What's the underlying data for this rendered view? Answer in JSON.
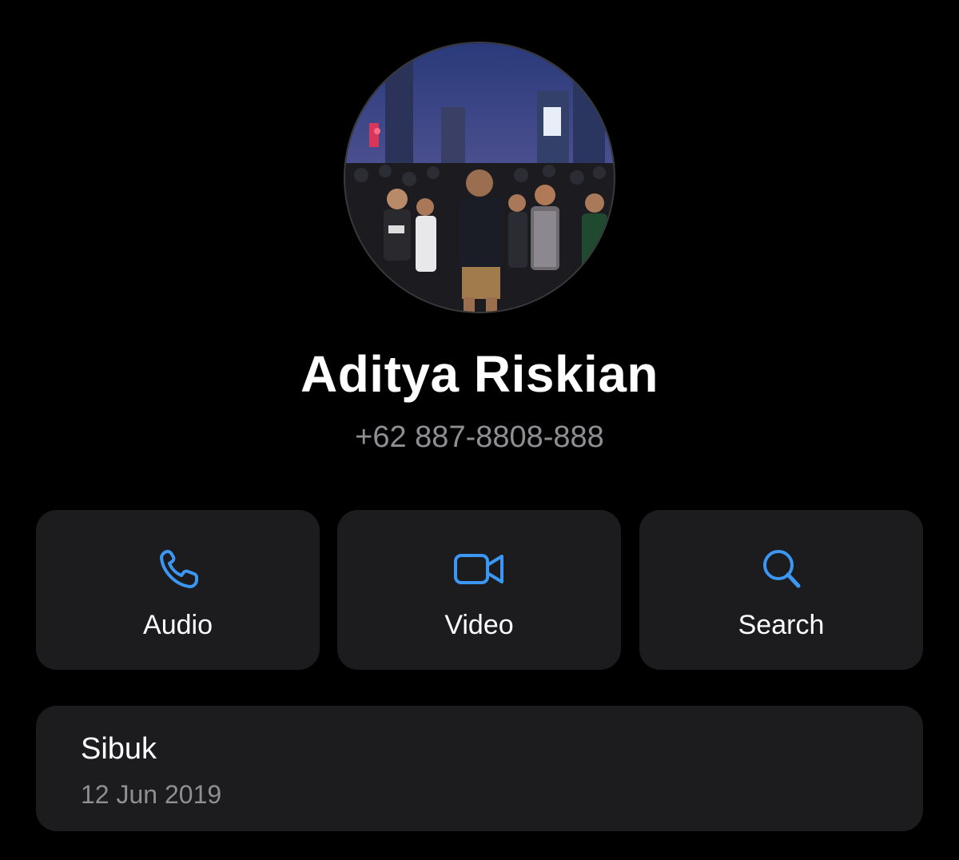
{
  "contact": {
    "name": "Aditya Riskian",
    "phone": "+62 887-8808-888",
    "avatar": "profile-photo"
  },
  "actions": [
    {
      "label": "Audio",
      "icon": "phone-icon"
    },
    {
      "label": "Video",
      "icon": "video-camera-icon"
    },
    {
      "label": "Search",
      "icon": "search-icon"
    }
  ],
  "about": {
    "text": "Sibuk",
    "date": "12 Jun 2019"
  },
  "colors": {
    "background": "#000000",
    "card": "#1c1c1e",
    "accent": "#3b97f3",
    "secondary_text": "#8e8e93",
    "primary_text": "#ffffff"
  }
}
